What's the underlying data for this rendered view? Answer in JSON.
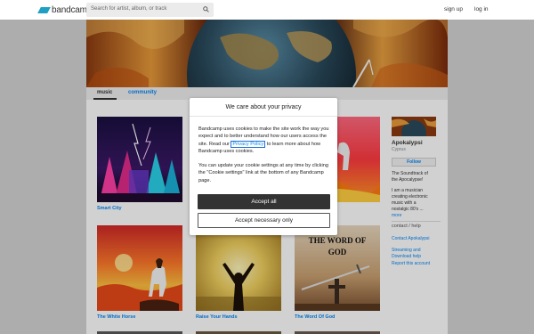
{
  "header": {
    "logo_text": "bandcamp",
    "search_placeholder": "Search for artist, album, or track",
    "signup_label": "sign up",
    "login_label": "log in"
  },
  "tabs": {
    "music": "music",
    "community": "community"
  },
  "releases": [
    {
      "title": "Smart City"
    },
    {
      "title": ""
    },
    {
      "title": ""
    },
    {
      "title": "The White Horse"
    },
    {
      "title": "Raise Your Hands"
    },
    {
      "title": "The Word Of God"
    }
  ],
  "album_art_text": {
    "word_of_god_line1": "THE WORD OF",
    "word_of_god_line2": "GOD"
  },
  "sidebar": {
    "artist_name": "Apokalypsi",
    "location": "Cyprus",
    "follow_label": "Follow",
    "bio_line1": "The Soundtrack of",
    "bio_line2": "the Apocalypse!",
    "bio_line3": "I am a musician",
    "bio_line4": "creating electronic",
    "bio_line5": "music with a",
    "bio_line6": "nostalgic 80's ...",
    "more_label": "more",
    "contact_heading": "contact / help",
    "contact_link": "Contact Apokalypsi",
    "streaming_line1": "Streaming and",
    "streaming_line2": "Download help",
    "report_link": "Report this account"
  },
  "cookie_dialog": {
    "title": "We care about your privacy",
    "para1_before": "Bandcamp uses cookies to make the site work the way you expect and to better understand how our users access the site. Read our ",
    "para1_link": "Privacy Policy",
    "para1_after": " to learn more about how Bandcamp uses cookies.",
    "para2": "You can update your cookie settings at any time by clicking the \"Cookie settings\" link at the bottom of any Bandcamp page.",
    "accept_all_label": "Accept all",
    "accept_necessary_label": "Accept necessary only"
  },
  "colors": {
    "link_blue": "#0687f5",
    "logo_blue": "#1da0c3",
    "dark_button": "#333333",
    "background_gray": "#d3d3d3"
  }
}
